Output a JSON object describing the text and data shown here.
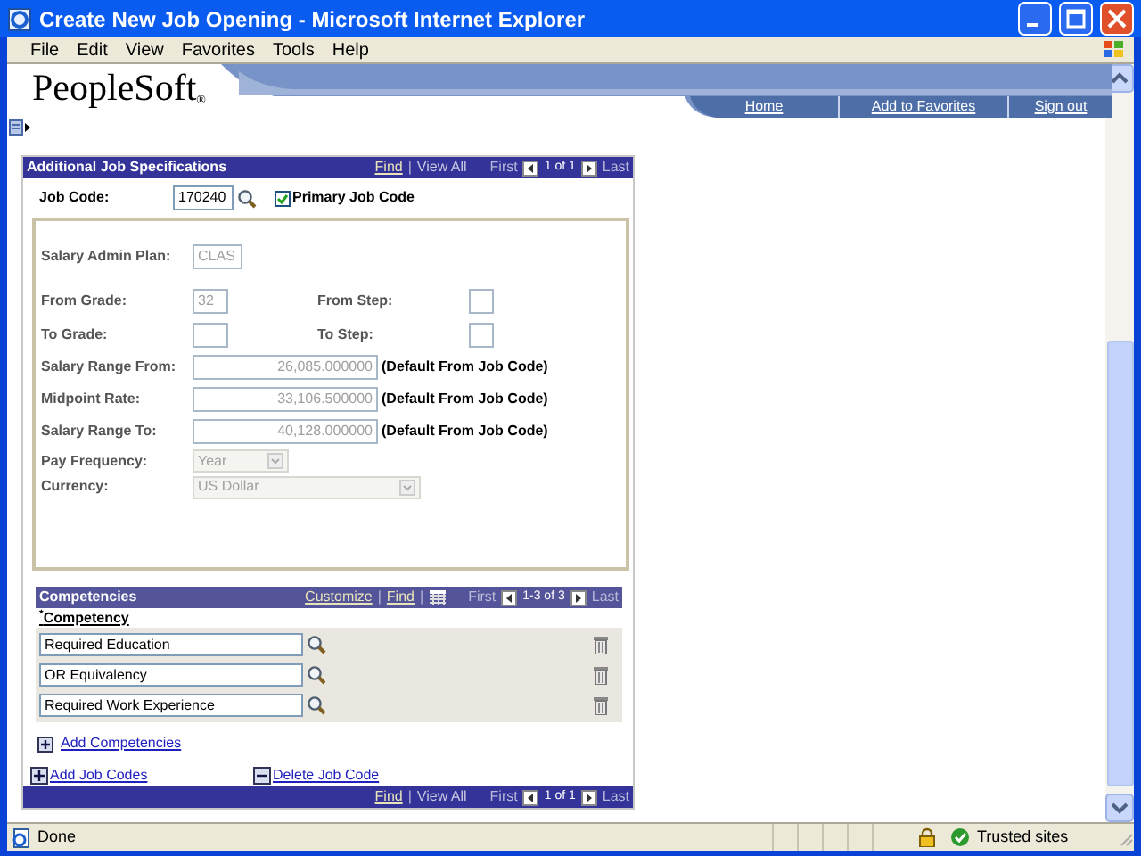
{
  "window": {
    "title": "Create New Job Opening - Microsoft Internet Explorer"
  },
  "menu": [
    "File",
    "Edit",
    "View",
    "Favorites",
    "Tools",
    "Help"
  ],
  "header": {
    "logo": "PeopleSoft",
    "logo_mark": "®",
    "links": [
      "Home",
      "Add to Favorites",
      "Sign out"
    ]
  },
  "section": {
    "title": "Additional Job Specifications",
    "find": "Find",
    "separator": "|",
    "view_all": "View All",
    "first": "First",
    "position": "1 of 1",
    "last": "Last"
  },
  "job_code": {
    "label": "Job Code:",
    "value": "170240",
    "primary": {
      "label": "Primary Job Code",
      "checked": true
    }
  },
  "fields": [
    {
      "kind": "short",
      "label": "Salary Admin Plan:",
      "value": "CLAS",
      "disabled": true
    },
    {
      "kind": "grade",
      "label": "From Grade:",
      "value": "32",
      "disabled": true,
      "step": {
        "label": "From Step:"
      }
    },
    {
      "kind": "grade",
      "label": "To Grade:",
      "step": {
        "label": "To Step:"
      }
    },
    {
      "kind": "amount",
      "label": "Salary Range From:",
      "value": "26,085.000000",
      "note": "(Default From Job Code)",
      "disabled": true
    },
    {
      "kind": "amount",
      "label": "Midpoint Rate:",
      "value": "33,106.500000",
      "note": "(Default From Job Code)",
      "disabled": true
    },
    {
      "kind": "amount",
      "label": "Salary Range To:",
      "value": "40,128.000000",
      "note": "(Default From Job Code)",
      "disabled": true
    },
    {
      "kind": "picklist",
      "label": "Pay Frequency:",
      "value": "Year",
      "disabled": true
    },
    {
      "kind": "widelist",
      "label": "Currency:",
      "value": "US Dollar",
      "disabled": true
    }
  ],
  "competencies": {
    "title": "Competencies",
    "customize": "Customize",
    "separator": "|",
    "find": "Find",
    "separator_2": "|",
    "first": "First",
    "position": "1-3 of 3",
    "last": "Last",
    "column": "$^{*}$Competency",
    "rows": [
      "Required Education",
      "OR Equivalency",
      "Required Work Experience"
    ],
    "add": "Add Competencies"
  },
  "actions": {
    "add": "Add Job Codes",
    "delete": "Delete Job Code"
  },
  "footer_nav": {
    "find": "Find",
    "separator": "|",
    "view_all": "View All",
    "first": "First",
    "position": "1 of 1",
    "last": "Last"
  },
  "status_bar": {
    "text": "Done",
    "zone": "Trusted sites"
  }
}
